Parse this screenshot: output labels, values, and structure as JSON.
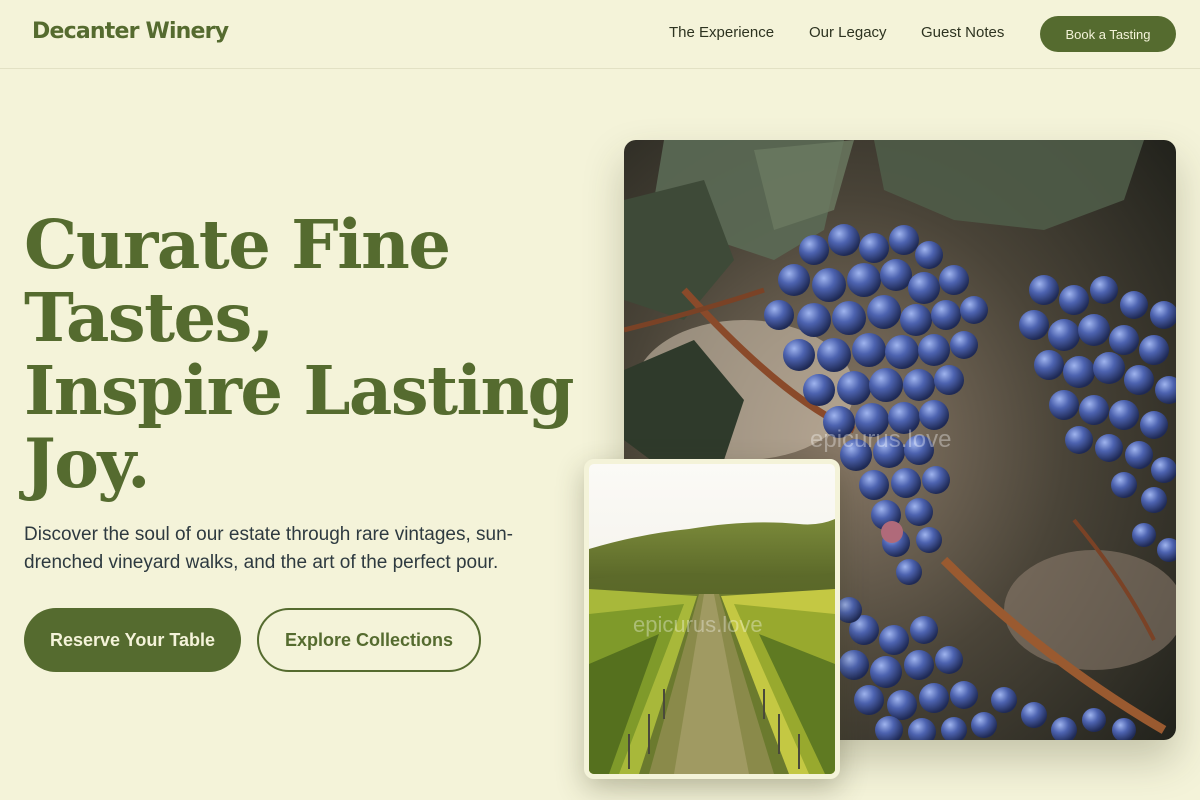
{
  "header": {
    "brand": "Decanter Winery",
    "nav": [
      {
        "label": "The Experience"
      },
      {
        "label": "Our Legacy"
      },
      {
        "label": "Guest Notes"
      }
    ],
    "cta": "Book a Tasting"
  },
  "hero": {
    "title_lines": [
      "Curate Fine",
      "Tastes,",
      "Inspire Lasting",
      "Joy."
    ],
    "subtitle": "Discover the soul of our estate through rare vintages, sun-drenched vineyard walks, and the art of the perfect pour.",
    "primary_cta": "Reserve Your Table",
    "secondary_cta": "Explore Collections"
  },
  "images": {
    "main": {
      "subject": "blue grape clusters on the vine",
      "watermark": "epicurus.love"
    },
    "inset": {
      "subject": "vineyard rows leading to a wooded hill",
      "watermark": "epicurus.love"
    }
  },
  "colors": {
    "background": "#f4f3d9",
    "accent": "#556b2f",
    "text": "#2e3a40"
  }
}
